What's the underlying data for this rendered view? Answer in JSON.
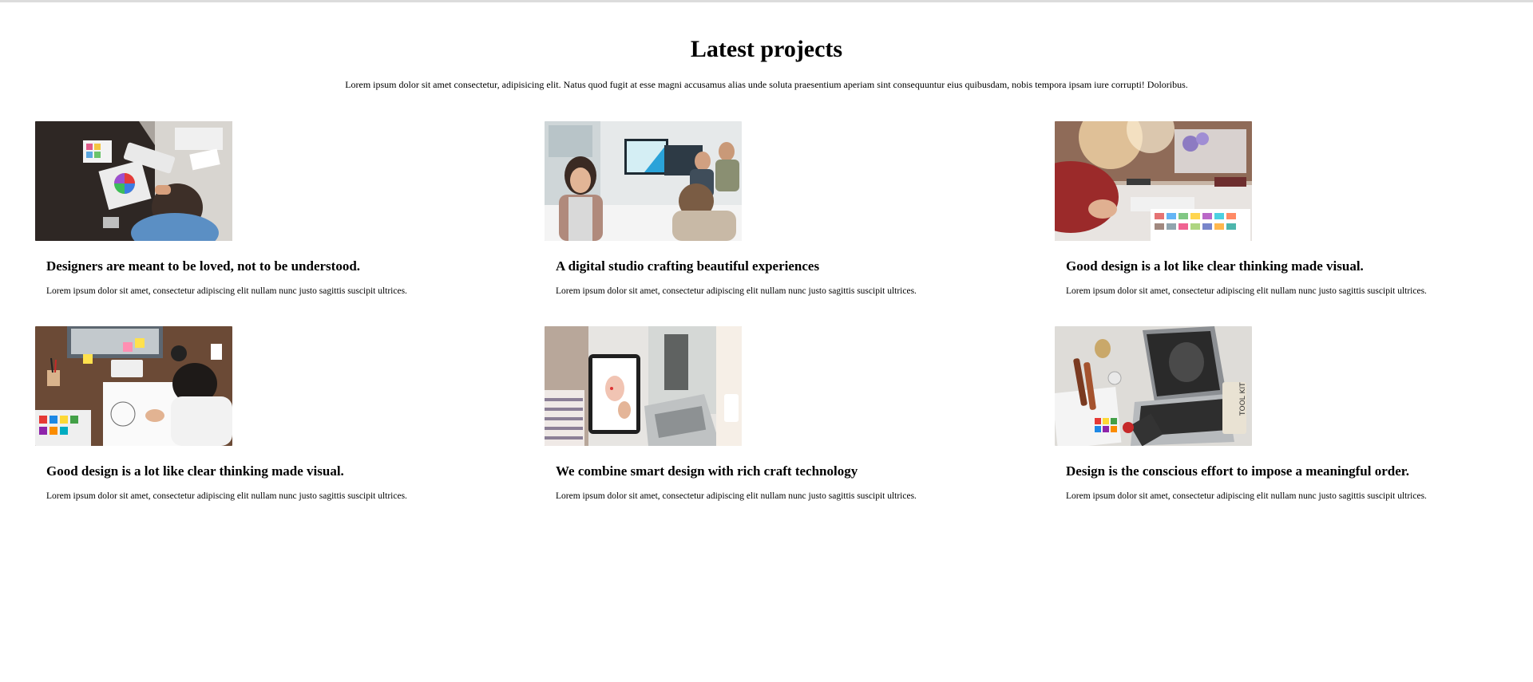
{
  "section": {
    "title": "Latest projects",
    "intro": "Lorem ipsum dolor sit amet consectetur, adipisicing elit. Natus quod fugit at esse magni accusamus alias unde soluta praesentium aperiam sint consequuntur eius quibusdam, nobis tempora ipsam iure corrupti! Doloribus."
  },
  "projects": [
    {
      "title": "Designers are meant to be loved, not to be understood.",
      "text": "Lorem ipsum dolor sit amet, consectetur adipiscing elit nullam nunc justo sagittis suscipit ultrices.",
      "image": "designer-desk-color-wheel-photo"
    },
    {
      "title": "A digital studio crafting beautiful experiences",
      "text": "Lorem ipsum dolor sit amet, consectetur adipiscing elit nullam nunc justo sagittis suscipit ultrices.",
      "image": "team-meeting-office-photo"
    },
    {
      "title": "Good design is a lot like clear thinking made visual.",
      "text": "Lorem ipsum dolor sit amet, consectetur adipiscing elit nullam nunc justo sagittis suscipit ultrices.",
      "image": "color-swatches-desk-photo"
    },
    {
      "title": "Good design is a lot like clear thinking made visual.",
      "text": "Lorem ipsum dolor sit amet, consectetur adipiscing elit nullam nunc justo sagittis suscipit ultrices.",
      "image": "sketching-workspace-photo"
    },
    {
      "title": "We combine smart design with rich craft technology",
      "text": "Lorem ipsum dolor sit amet, consectetur adipiscing elit nullam nunc justo sagittis suscipit ultrices.",
      "image": "tablet-drawing-photo"
    },
    {
      "title": "Design is the conscious effort to impose a meaningful order.",
      "text": "Lorem ipsum dolor sit amet, consectetur adipiscing elit nullam nunc justo sagittis suscipit ultrices.",
      "image": "laptop-tool-kit-photo"
    }
  ],
  "image_text": {
    "tool_kit": "TOOL KIT"
  }
}
